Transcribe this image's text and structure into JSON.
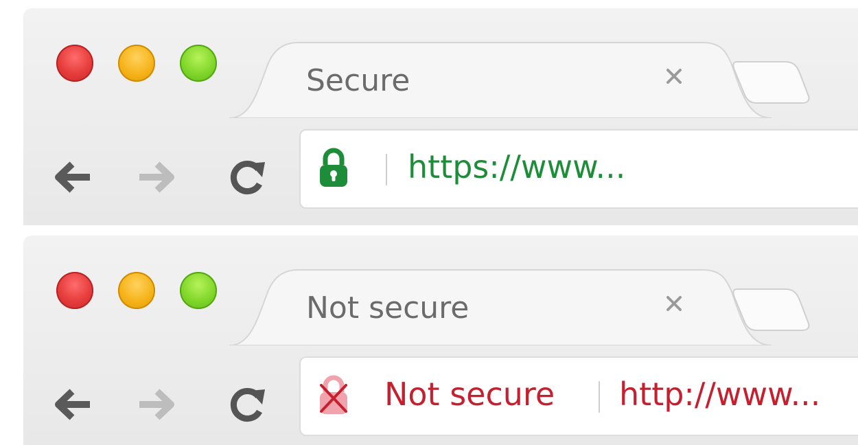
{
  "browsers": [
    {
      "tab": {
        "title": "Secure",
        "close_glyph": "×"
      },
      "nav": {
        "back_icon": "back-arrow-icon",
        "forward_icon": "forward-arrow-icon",
        "reload_icon": "reload-icon"
      },
      "address_bar": {
        "security_icon": "lock-icon",
        "url": "https://www...",
        "url_color": "#1e8d3a"
      }
    },
    {
      "tab": {
        "title": "Not secure",
        "close_glyph": "×"
      },
      "nav": {
        "back_icon": "back-arrow-icon",
        "forward_icon": "forward-arrow-icon",
        "reload_icon": "reload-icon"
      },
      "address_bar": {
        "security_icon": "broken-lock-icon",
        "status": "Not secure",
        "url": "http://www...",
        "url_color": "#c5202f"
      }
    }
  ],
  "colors": {
    "traffic_red": "#e53b3b",
    "traffic_yellow": "#f6b319",
    "traffic_green": "#80d62a",
    "secure_green": "#1e8d3a",
    "insecure_red": "#c5202f",
    "insecure_icon_pink": "#f1a3ad"
  }
}
